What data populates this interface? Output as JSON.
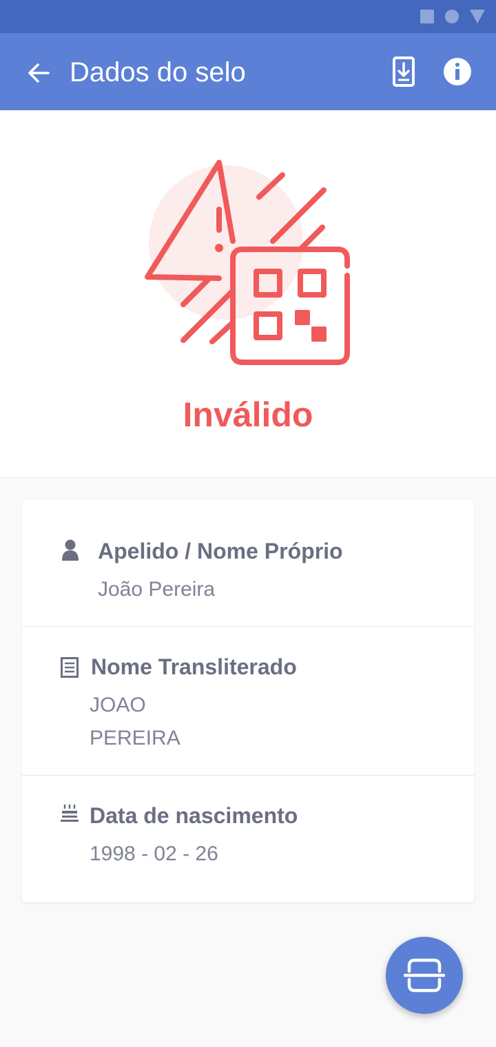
{
  "status_bar": {
    "icons": [
      "square-icon",
      "circle-icon",
      "triangle-icon"
    ]
  },
  "app_bar": {
    "title": "Dados do selo",
    "back_icon": "arrow-left-icon",
    "download_icon": "download-icon",
    "info_icon": "info-icon"
  },
  "hero": {
    "icon": "invalid-qr-warning-icon",
    "status": "Inválido"
  },
  "details": {
    "name": {
      "icon": "person-icon",
      "label": "Apelido / Nome Próprio",
      "value": "João Pereira"
    },
    "transliterated": {
      "icon": "document-icon",
      "label": "Nome Transliterado",
      "value_line1": "JOAO",
      "value_line2": "PEREIRA"
    },
    "birth": {
      "icon": "cake-icon",
      "label": "Data de nascimento",
      "value": "1998 - 02 - 26"
    }
  },
  "fab": {
    "icon": "scan-icon"
  },
  "colors": {
    "status_bar": "#4468bd",
    "app_bar": "#5b80d6",
    "accent_invalid": "#f05a5b",
    "label_text": "#6a6f82",
    "value_text": "#7f8394"
  }
}
